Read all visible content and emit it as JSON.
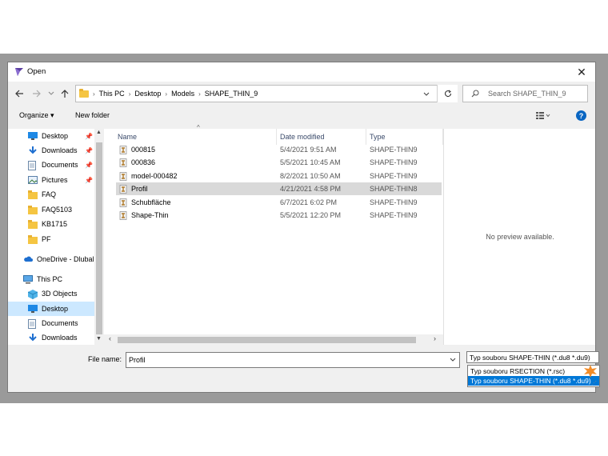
{
  "window": {
    "title": "Open",
    "close_glyph": "✕"
  },
  "address_bar": {
    "breadcrumbs": [
      "This PC",
      "Desktop",
      "Models",
      "SHAPE_THIN_9"
    ],
    "search_placeholder": "Search SHAPE_THIN_9"
  },
  "toolbar": {
    "organize": "Organize ▾",
    "new_folder": "New folder",
    "help": "?"
  },
  "nav_pane": [
    {
      "label": "Desktop",
      "icon": "desktop-icon",
      "pinned": true
    },
    {
      "label": "Downloads",
      "icon": "download-icon",
      "pinned": true
    },
    {
      "label": "Documents",
      "icon": "document-icon",
      "pinned": true
    },
    {
      "label": "Pictures",
      "icon": "picture-icon",
      "pinned": true
    },
    {
      "label": "FAQ",
      "icon": "folder-icon",
      "pinned": false
    },
    {
      "label": "FAQ5103",
      "icon": "folder-icon",
      "pinned": false
    },
    {
      "label": "KB1715",
      "icon": "folder-icon",
      "pinned": false
    },
    {
      "label": "PF",
      "icon": "folder-icon",
      "pinned": false
    },
    {
      "label": "OneDrive - Dlubal",
      "icon": "cloud-icon",
      "pinned": false
    },
    {
      "label": "This PC",
      "icon": "computer-icon",
      "pinned": false
    },
    {
      "label": "3D Objects",
      "icon": "cube-icon",
      "pinned": false
    },
    {
      "label": "Desktop",
      "icon": "desktop-icon",
      "pinned": false,
      "selected": true
    },
    {
      "label": "Documents",
      "icon": "document-icon",
      "pinned": false
    },
    {
      "label": "Downloads",
      "icon": "download-icon",
      "pinned": false
    }
  ],
  "file_list": {
    "columns": [
      "Name",
      "Date modified",
      "Type"
    ],
    "rows": [
      {
        "name": "000815",
        "date": "5/4/2021 9:51 AM",
        "type": "SHAPE-THIN9"
      },
      {
        "name": "000836",
        "date": "5/5/2021 10:45 AM",
        "type": "SHAPE-THIN9"
      },
      {
        "name": "model-000482",
        "date": "8/2/2021 10:50 AM",
        "type": "SHAPE-THIN9"
      },
      {
        "name": "Profil",
        "date": "4/21/2021 4:58 PM",
        "type": "SHAPE-THIN8",
        "selected": true
      },
      {
        "name": "Schubfläche",
        "date": "6/7/2021 6:02 PM",
        "type": "SHAPE-THIN9"
      },
      {
        "name": "Shape-Thin",
        "date": "5/5/2021 12:20 PM",
        "type": "SHAPE-THIN9"
      }
    ]
  },
  "preview": {
    "text": "No preview available."
  },
  "bottom": {
    "file_name_label": "File name:",
    "file_name_value": "Profil",
    "file_type_value": "Typ souboru SHAPE-THIN (*.du8 *.du9)",
    "file_type_options": [
      "Typ souboru RSECTION (*.rsc)",
      "Typ souboru SHAPE-THIN (*.du8 *.du9)"
    ]
  },
  "colors": {
    "accent": "#0078d7",
    "selection": "#cce8ff",
    "folder": "#f5c542",
    "marker": "#f28c28"
  }
}
